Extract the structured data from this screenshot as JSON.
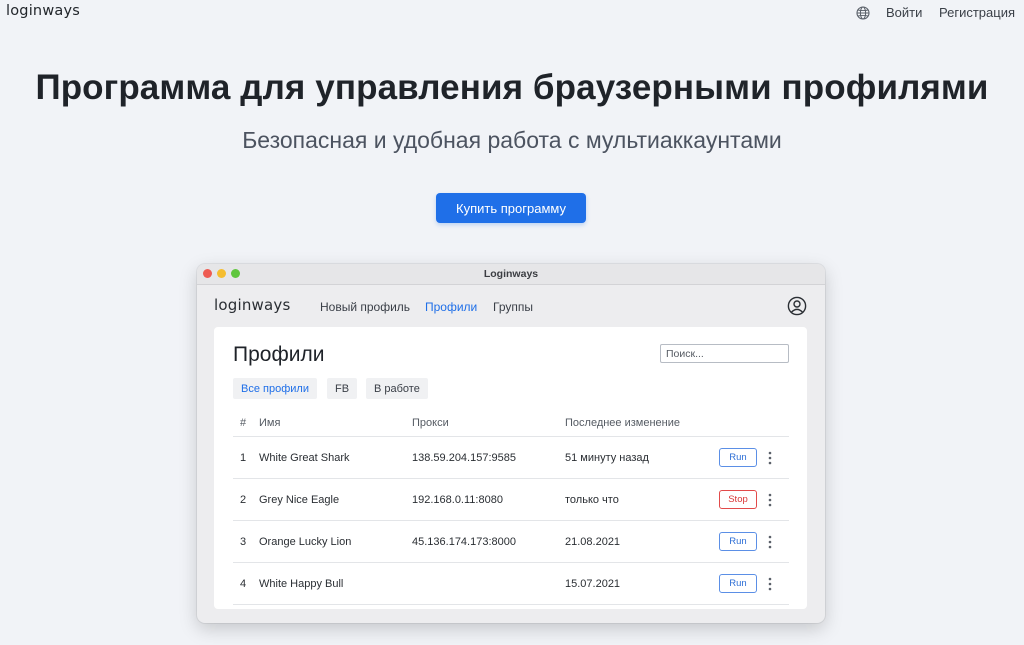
{
  "site": {
    "logo": "loginways",
    "nav": {
      "globe_icon": "globe-icon",
      "login": "Войти",
      "register": "Регистрация"
    }
  },
  "hero": {
    "title": "Программа для управления браузерными профилями",
    "subtitle": "Безопасная и удобная работа с мультиаккаунтами",
    "cta": "Купить программу"
  },
  "app": {
    "window_title": "Loginways",
    "logo": "loginways",
    "nav": [
      "Новый профиль",
      "Профили",
      "Группы"
    ],
    "active_nav": "Профили",
    "account_icon": "user-circle-icon",
    "panel": {
      "title": "Профили",
      "search_placeholder": "Поиск...",
      "filters": [
        "Все профили",
        "FB",
        "В работе"
      ],
      "active_filter": "Все профили",
      "columns": [
        "#",
        "Имя",
        "Прокси",
        "Последнее изменение"
      ],
      "rows": [
        {
          "num": "1",
          "name": "White Great Shark",
          "proxy": "138.59.204.157:9585",
          "changed": "51 минуту назад",
          "action": "Run"
        },
        {
          "num": "2",
          "name": "Grey Nice Eagle",
          "proxy": "192.168.0.11:8080",
          "changed": "только что",
          "action": "Stop"
        },
        {
          "num": "3",
          "name": "Orange Lucky Lion",
          "proxy": "45.136.174.173:8000",
          "changed": "21.08.2021",
          "action": "Run"
        },
        {
          "num": "4",
          "name": "White Happy Bull",
          "proxy": "",
          "changed": "15.07.2021",
          "action": "Run"
        }
      ]
    }
  },
  "colors": {
    "accent": "#1f6fe8",
    "background": "#f1f3f7",
    "stop": "#e24a4a"
  }
}
